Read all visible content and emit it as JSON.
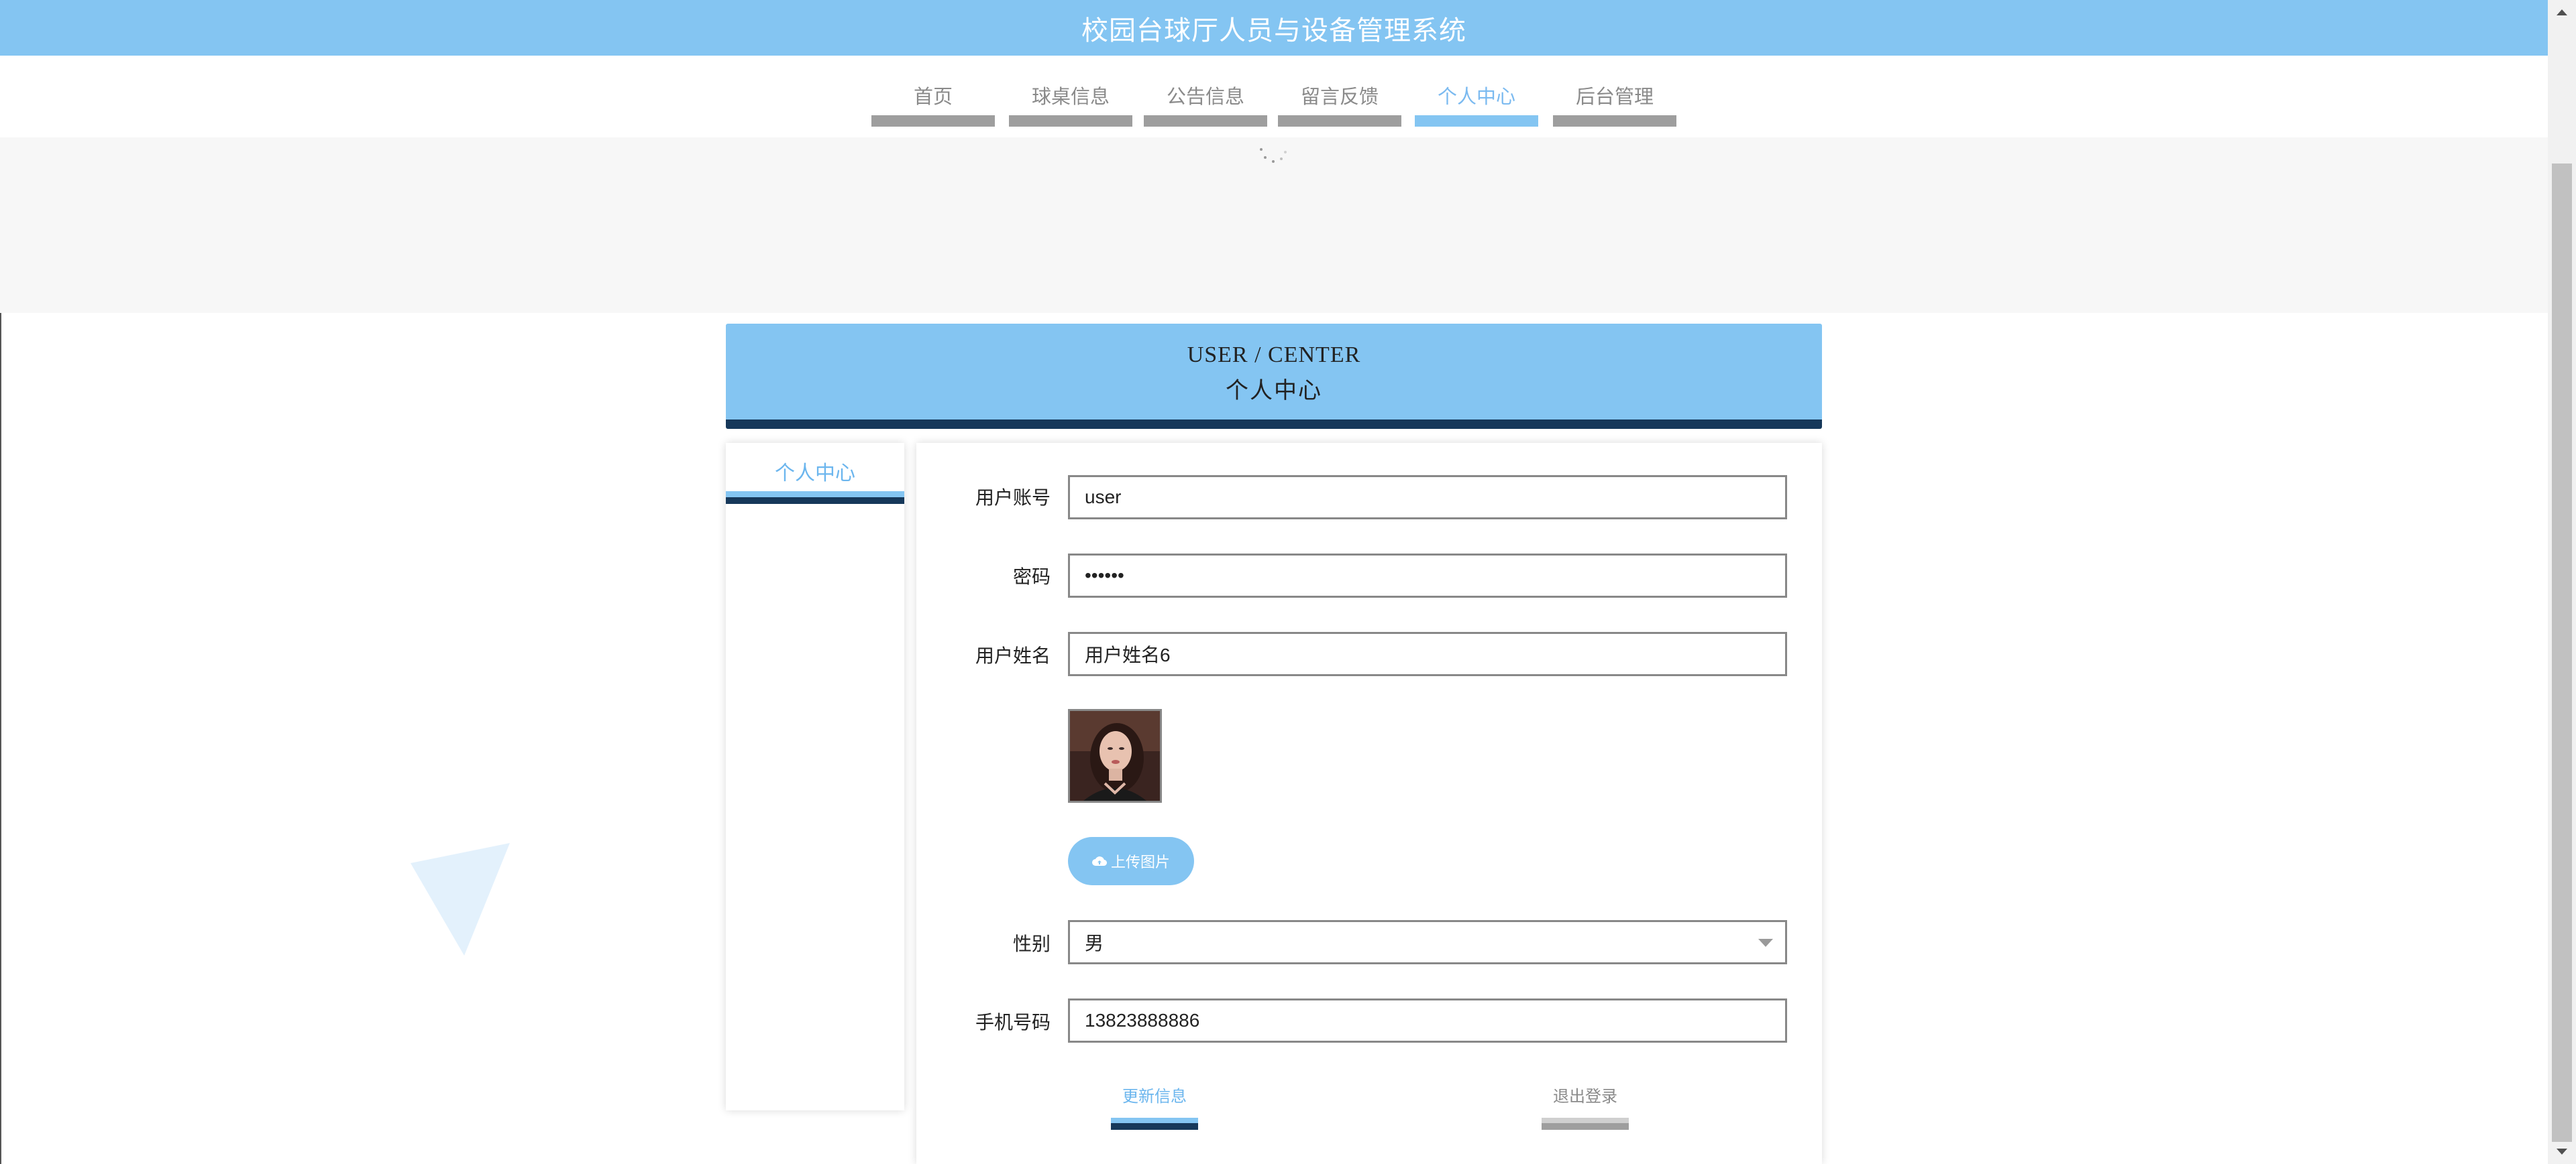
{
  "header": {
    "title": "校园台球厅人员与设备管理系统"
  },
  "nav": {
    "items": [
      {
        "label": "首页"
      },
      {
        "label": "球桌信息"
      },
      {
        "label": "公告信息"
      },
      {
        "label": "留言反馈"
      },
      {
        "label": "个人中心"
      },
      {
        "label": "后台管理"
      }
    ],
    "active_index": 4
  },
  "section": {
    "title_en": "USER / CENTER",
    "title_zh": "个人中心"
  },
  "sidebar": {
    "items": [
      {
        "label": "个人中心"
      }
    ]
  },
  "form": {
    "account": {
      "label": "用户账号",
      "value": "user"
    },
    "password": {
      "label": "密码",
      "value": "••••••"
    },
    "name": {
      "label": "用户姓名",
      "value": "用户姓名6"
    },
    "upload_label": "上传图片",
    "gender": {
      "label": "性别",
      "value": "男"
    },
    "phone": {
      "label": "手机号码",
      "value": "13823888886"
    }
  },
  "actions": {
    "update": "更新信息",
    "logout": "退出登录"
  },
  "colors": {
    "accent": "#84c5f2",
    "dark": "#16385a",
    "inactive_bar": "#9e9e9e"
  },
  "icons": [
    "cloud-upload-icon",
    "chevron-down-icon",
    "loading-spinner-icon"
  ]
}
